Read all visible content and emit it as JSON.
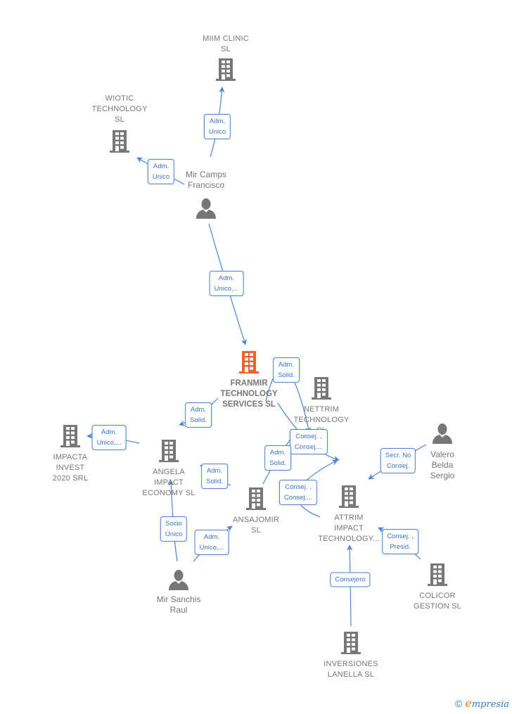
{
  "colors": {
    "edge": "#4a86d8",
    "node_icon": "#777777",
    "focus_icon": "#f0622d",
    "label_text": "#777777",
    "edge_label_text": "#3a76c8"
  },
  "nodes": [
    {
      "id": "miim",
      "type": "company",
      "icon": "building-icon",
      "lines": [
        "MIIM CLINIC",
        "SL"
      ]
    },
    {
      "id": "wiotic",
      "type": "company",
      "icon": "building-icon",
      "lines": [
        "WIOTIC",
        "TECHNOLOGY",
        "SL"
      ]
    },
    {
      "id": "mircamps",
      "type": "person",
      "icon": "person-icon",
      "lines": [
        "Mir Camps",
        "Francisco"
      ]
    },
    {
      "id": "franmir",
      "type": "focus",
      "icon": "building-icon",
      "lines": [
        "FRANMIR",
        "TECHNOLOGY",
        "SERVICES  SL"
      ]
    },
    {
      "id": "nettrim",
      "type": "company",
      "icon": "building-icon",
      "lines": [
        "NETTRIM",
        "TECHNOLOGY",
        "SL"
      ]
    },
    {
      "id": "impacta",
      "type": "company",
      "icon": "building-icon",
      "lines": [
        "IMPACTA",
        "INVEST",
        "2020 SRL"
      ]
    },
    {
      "id": "angela",
      "type": "company",
      "icon": "building-icon",
      "lines": [
        "ANGELA",
        "IMPACT",
        "ECONOMY  SL"
      ]
    },
    {
      "id": "ansajomir",
      "type": "company",
      "icon": "building-icon",
      "lines": [
        "ANSAJOMIR",
        "SL"
      ]
    },
    {
      "id": "attrim",
      "type": "company",
      "icon": "building-icon",
      "lines": [
        "ATTRIM",
        "IMPACT",
        "TECHNOLOGY..."
      ]
    },
    {
      "id": "valero",
      "type": "person",
      "icon": "person-icon",
      "lines": [
        "Valero",
        "Belda",
        "Sergio"
      ]
    },
    {
      "id": "mirsanchis",
      "type": "person",
      "icon": "person-icon",
      "lines": [
        "Mir Sanchis",
        "Raul"
      ]
    },
    {
      "id": "colicor",
      "type": "company",
      "icon": "building-icon",
      "lines": [
        "COLICOR",
        "GESTION  SL"
      ]
    },
    {
      "id": "inversiones",
      "type": "company",
      "icon": "building-icon",
      "lines": [
        "INVERSIONES",
        "LANELLA  SL"
      ]
    }
  ],
  "edges": [
    {
      "from": "mircamps",
      "to": "miim",
      "label": [
        "Adm.",
        "Unico"
      ]
    },
    {
      "from": "mircamps",
      "to": "wiotic",
      "label": [
        "Adm.",
        "Unico"
      ]
    },
    {
      "from": "mircamps",
      "to": "franmir",
      "label": [
        "Adm.",
        "Unico,..."
      ]
    },
    {
      "from": "franmir",
      "to": "nettrim",
      "label": [
        "Adm.",
        "Solid."
      ]
    },
    {
      "from": "franmir",
      "to": "angela",
      "label": [
        "Adm.",
        "Solid."
      ]
    },
    {
      "from": "angela",
      "to": "impacta",
      "label": [
        "Adm.",
        "Unico,..."
      ]
    },
    {
      "from": "franmir",
      "to": "attrim",
      "label": [
        "Consej. ,",
        "Consej...."
      ]
    },
    {
      "from": "ansajomir",
      "to": "nettrim",
      "label": [
        "Adm.",
        "Solid."
      ]
    },
    {
      "from": "ansajomir",
      "to": "angela",
      "label": [
        "Adm.",
        "Solid."
      ]
    },
    {
      "from": "ansajomir",
      "to": "attrim",
      "label": [
        "Consej. ,",
        "Consej...."
      ]
    },
    {
      "from": "valero",
      "to": "attrim",
      "label": [
        "Secr.  No",
        "Consej."
      ]
    },
    {
      "from": "colicor",
      "to": "attrim",
      "label": [
        "Consej. ,",
        "Presid."
      ]
    },
    {
      "from": "mirsanchis",
      "to": "angela",
      "label": [
        "Socio",
        "Único"
      ]
    },
    {
      "from": "mirsanchis",
      "to": "ansajomir",
      "label": [
        "Adm.",
        "Unico,..."
      ]
    },
    {
      "from": "inversiones",
      "to": "attrim",
      "label": [
        "Consejero"
      ]
    }
  ],
  "footer": {
    "copyright_symbol": "©",
    "brand_first": "e",
    "brand_rest": "mpresia"
  }
}
